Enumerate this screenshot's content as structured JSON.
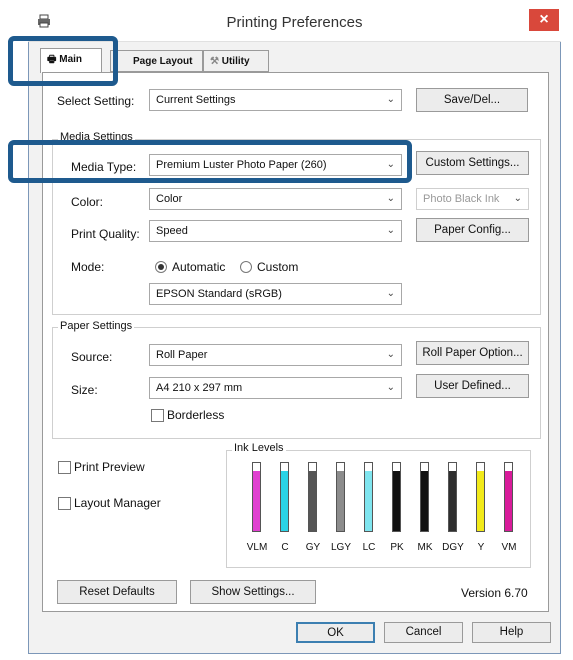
{
  "window": {
    "title": "Printing Preferences",
    "close_symbol": "×"
  },
  "tabs": [
    {
      "label": "Main"
    },
    {
      "label": "Page Layout"
    },
    {
      "label": "Utility"
    }
  ],
  "select_setting": {
    "label": "Select Setting:",
    "value": "Current Settings",
    "button": "Save/Del..."
  },
  "media_settings": {
    "legend": "Media Settings",
    "media_type": {
      "label": "Media Type:",
      "value": "Premium Luster Photo Paper (260)",
      "button": "Custom Settings..."
    },
    "color": {
      "label": "Color:",
      "value": "Color",
      "ink_value": "Photo Black Ink"
    },
    "print_quality": {
      "label": "Print Quality:",
      "value": "Speed",
      "button": "Paper Config..."
    },
    "mode": {
      "label": "Mode:",
      "automatic": "Automatic",
      "custom": "Custom",
      "value": "EPSON Standard (sRGB)"
    }
  },
  "paper_settings": {
    "legend": "Paper Settings",
    "source": {
      "label": "Source:",
      "value": "Roll Paper",
      "button": "Roll Paper Option..."
    },
    "size": {
      "label": "Size:",
      "value": "A4 210 x 297 mm",
      "button": "User Defined..."
    },
    "borderless": "Borderless"
  },
  "print_preview": "Print Preview",
  "layout_manager": "Layout Manager",
  "ink_levels": {
    "legend": "Ink Levels",
    "inks": [
      {
        "name": "VLM",
        "color": "#e040d0",
        "level": 0.88
      },
      {
        "name": "C",
        "color": "#2ad3e6",
        "level": 0.88
      },
      {
        "name": "GY",
        "color": "#555555",
        "level": 0.88
      },
      {
        "name": "LGY",
        "color": "#8c8c8c",
        "level": 0.88
      },
      {
        "name": "LC",
        "color": "#7fe5ef",
        "level": 0.88
      },
      {
        "name": "PK",
        "color": "#111111",
        "level": 0.88
      },
      {
        "name": "MK",
        "color": "#111111",
        "level": 0.88
      },
      {
        "name": "DGY",
        "color": "#2e2e2e",
        "level": 0.88
      },
      {
        "name": "Y",
        "color": "#f2ea1a",
        "level": 0.88
      },
      {
        "name": "VM",
        "color": "#d81b9a",
        "level": 0.88
      }
    ]
  },
  "bottom": {
    "reset": "Reset Defaults",
    "show": "Show Settings...",
    "version": "Version 6.70"
  },
  "footer": {
    "ok": "OK",
    "cancel": "Cancel",
    "help": "Help"
  },
  "arrow_glyph": "⌄"
}
